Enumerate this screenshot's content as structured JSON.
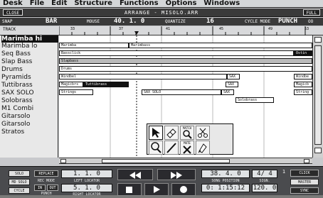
{
  "menu": [
    "Desk",
    "File",
    "Edit",
    "Structure",
    "Functions",
    "Options",
    "Windows"
  ],
  "window": {
    "close_label": "CLOSE",
    "title": "ARRANGE - MISOLO.ARR",
    "full_label": "FULL"
  },
  "info": {
    "snap_label": "SNAP",
    "snap_value": "BAR",
    "mouse_label": "MOUSE",
    "mouse_value": "40. 1. 0",
    "quantize_label": "QUANTIZE",
    "quantize_value": "16",
    "cycle_label": "CYCLE MODE",
    "cycle_value": "PUNCH",
    "extra": "OO"
  },
  "ruler": {
    "track_header": "TRACK",
    "bars": [
      "33",
      "37",
      "41",
      "45",
      "49",
      "53"
    ]
  },
  "tracks": [
    "Marimba hi",
    "Marimba lo",
    "Seq Bass",
    "Slap Bass",
    "Drums",
    "Pyramids",
    "Tuttibrass",
    "SAX SOLO",
    "Solobrass",
    "M1 Combi",
    "Gitarsolo",
    "Gitarsolo",
    "Stratos"
  ],
  "parts": {
    "marimba_lo_a": "Marimba",
    "marimba_lo_b": "Marimbass",
    "seqbass_a": "Bassclick",
    "seqbass_b": "Ostin",
    "slap": "Slapbass",
    "drums": "Drums",
    "pyr_a": "Windbel",
    "pyr_b": "SAX",
    "pyr_c": "Windbe",
    "tutti_a": "Magicbrs",
    "tutti_b": "Tuttibrass",
    "tutti_c": "SAX",
    "tutti_d": "Magicb",
    "sax_a": "Strings",
    "sax_b": "SAX SOLO",
    "sax_c": "SAX",
    "sax_d": "String",
    "solobrass": "Solobrass"
  },
  "toolbox": {
    "match_label": "MATCH",
    "mute_label": "MUTE"
  },
  "transport": {
    "solo": "SOLO",
    "replace": "REPLACE",
    "left_locator": "1. 1. 0",
    "left_locator_label": "LEFT LOCATOR",
    "md_solo": "MD SOLO",
    "rec_mode": "REC MODE",
    "cycle": "CYCLE",
    "in": "IN",
    "out": "OUT",
    "punch": "PUNCH",
    "right_locator": "5. 1. 0",
    "right_locator_label": "RIGHT LOCATOR",
    "song_position": "38. 4. 0",
    "song_position_label": "SONG POSITION",
    "signature": "4/ 4",
    "signature_label": "SIGN.",
    "sig_extra": "1",
    "smpte": "0: 1:15:12",
    "tempo": "120. 0",
    "click": "CLICK",
    "master": "MASTER",
    "sync": "SYNC"
  },
  "colors": {
    "background": "#c8c9cc",
    "dark": "#3a3a3a",
    "lcd": "#dfe2e4"
  }
}
